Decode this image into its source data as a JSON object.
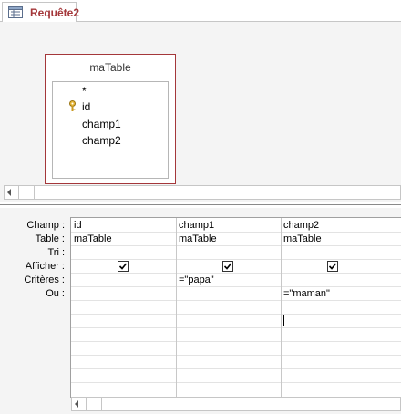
{
  "tab": {
    "title": "Requête2",
    "icon": "query-icon"
  },
  "table": {
    "name": "maTable",
    "fields": [
      "*",
      "id",
      "champ1",
      "champ2"
    ],
    "key_field": "id"
  },
  "grid": {
    "row_labels": {
      "champ": "Champ :",
      "table": "Table :",
      "tri": "Tri :",
      "afficher": "Afficher :",
      "criteres": "Critères :",
      "ou": "Ou :"
    },
    "columns": [
      {
        "champ": "id",
        "table": "maTable",
        "afficher": true,
        "criteres": "",
        "ou": ""
      },
      {
        "champ": "champ1",
        "table": "maTable",
        "afficher": true,
        "criteres": "=\"papa\"",
        "ou": ""
      },
      {
        "champ": "champ2",
        "table": "maTable",
        "afficher": true,
        "criteres": "",
        "ou": "=\"maman\""
      }
    ]
  },
  "colors": {
    "accent": "#a4373a",
    "background": "#f4f4f4"
  }
}
